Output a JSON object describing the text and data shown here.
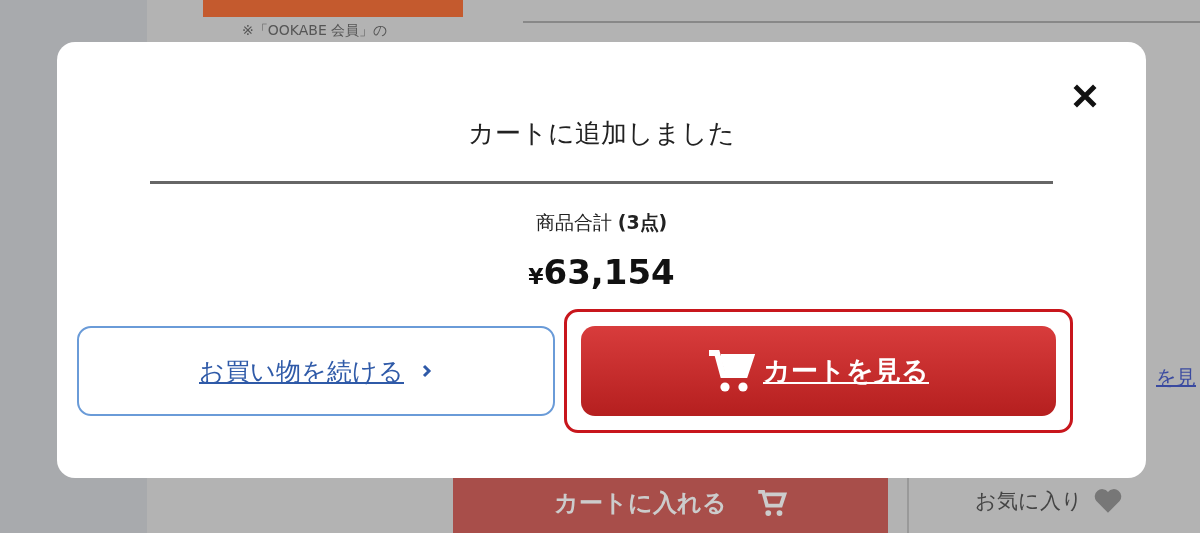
{
  "background": {
    "notice": "※「OOKABE 会員」の",
    "link": "を見",
    "add_to_cart": "カートに入れる",
    "favorite": "お気に入り"
  },
  "modal": {
    "title": "カートに追加しました",
    "subtotal": "商品合計 **(3点)**",
    "currency": "¥",
    "amount": "63,154",
    "buttons": [
      {
        "label": "お買い物を続ける",
        "kind": "continue",
        "focused": false
      },
      {
        "label": "カートを見る",
        "kind": "cart",
        "focused": true
      }
    ]
  }
}
